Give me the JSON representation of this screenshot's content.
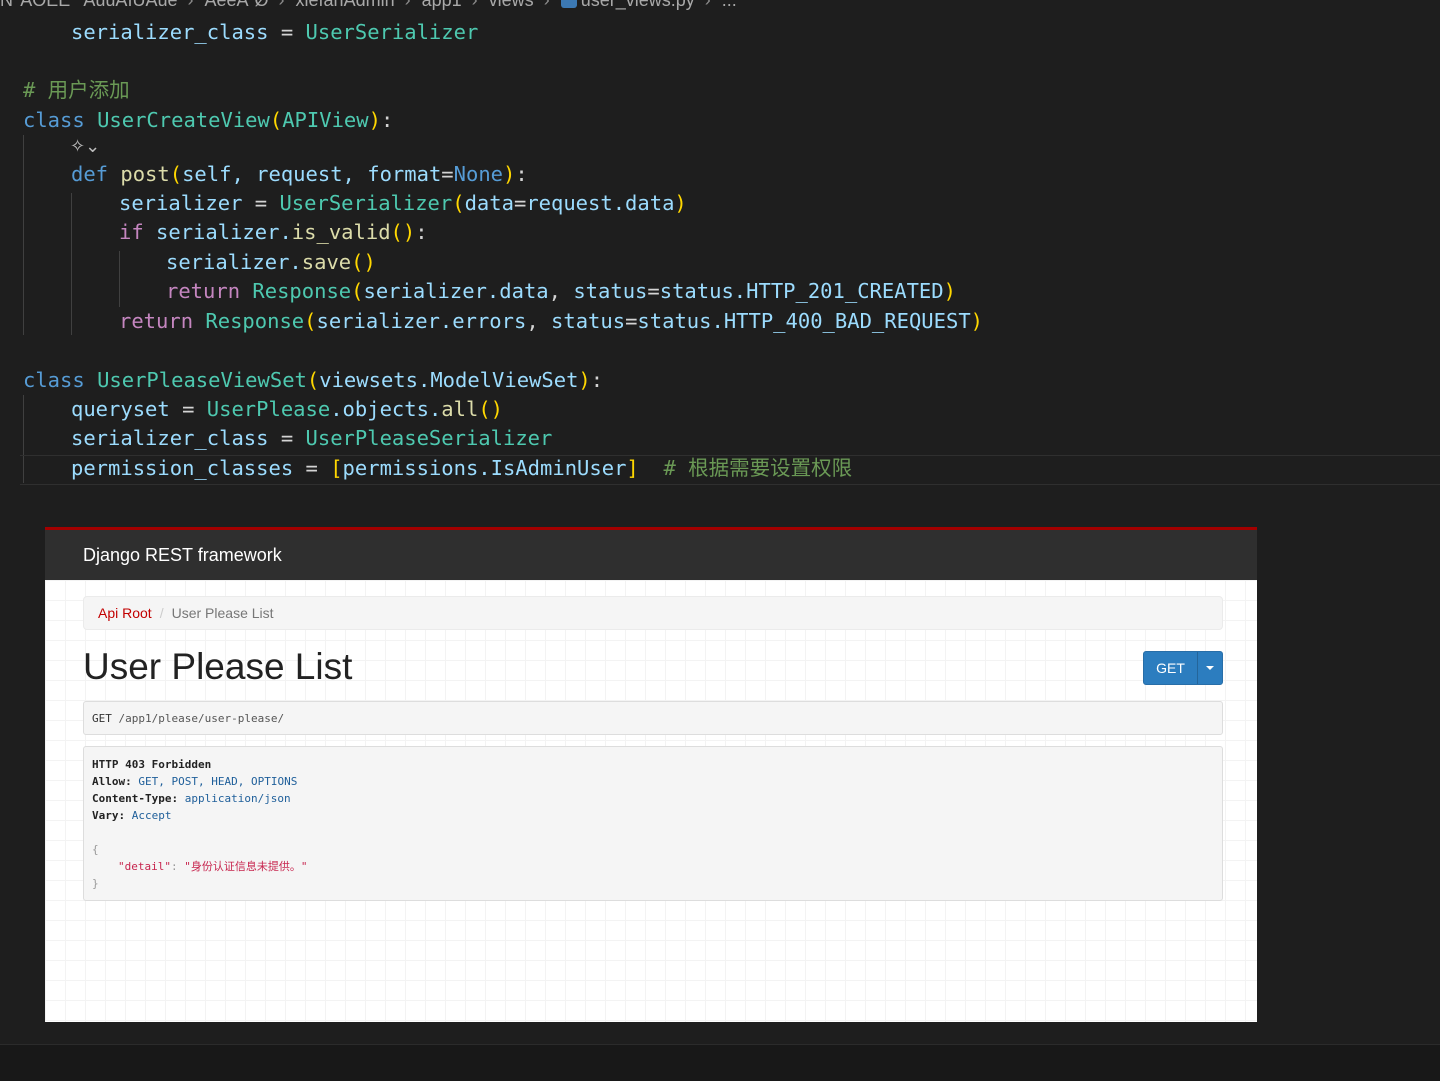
{
  "editor": {
    "breadcrumb": [
      "Ñ°ÂÖÉÊ¨°ÂüüÂïÜÂüé",
      "ÂêéÁ´Ø",
      "xiefanAdmin",
      "app1",
      "views",
      "user_views.py",
      "..."
    ],
    "lines": {
      "l1_var": "serializer_class",
      "l1_eq": " = ",
      "l1_cls": "UserSerializer",
      "l2_comment": "# 用户添加",
      "l3_kw": "class",
      "l3_name": "UserCreateView",
      "l3_base": "APIView",
      "l4_kw": "def",
      "l4_fn": "post",
      "l4_args": "self, request, ",
      "l4_kwarg": "format",
      "l4_default": "None",
      "l5_var": "serializer",
      "l5_cls": "UserSerializer",
      "l5_arg": "data",
      "l5_val": "request.data",
      "l6_kw": "if",
      "l6_expr": "serializer.",
      "l6_fn": "is_valid",
      "l7_obj": "serializer.",
      "l7_fn": "save",
      "l8_kw": "return",
      "l8_cls": "Response",
      "l8_arg1": "serializer.data",
      "l8_kw2": "status",
      "l8_val": "status.HTTP_201_CREATED",
      "l9_kw": "return",
      "l9_cls": "Response",
      "l9_arg1": "serializer.errors",
      "l9_kw2": "status",
      "l9_val": "status.HTTP_400_BAD_REQUEST",
      "l10_kw": "class",
      "l10_name": "UserPleaseViewSet",
      "l10_base": "viewsets.ModelViewSet",
      "l11_var": "queryset",
      "l11_cls": "UserPlease",
      "l11_rest": ".objects.",
      "l11_fn": "all",
      "l12_var": "serializer_class",
      "l12_cls": "UserPleaseSerializer",
      "l13_var": "permission_classes",
      "l13_val": "permissions.IsAdminUser",
      "l13_comment": "# 根据需要设置权限"
    }
  },
  "drf": {
    "brand": "Django REST framework",
    "breadcrumb_root": "Api Root",
    "breadcrumb_current": "User Please List",
    "title": "User Please List",
    "get_button": "GET",
    "request": {
      "method": "GET",
      "path": "/app1/please/user-please/"
    },
    "response": {
      "status": "HTTP 403 Forbidden",
      "allow_label": "Allow:",
      "allow_value": "GET, POST, HEAD, OPTIONS",
      "content_type_label": "Content-Type:",
      "content_type_value": "application/json",
      "vary_label": "Vary:",
      "vary_value": "Accept",
      "open_brace": "{",
      "detail_key": "\"detail\"",
      "detail_colon": ": ",
      "detail_value": "\"身份认证信息未提供。\"",
      "close_brace": "}"
    },
    "colors": {
      "nav_bg": "#2f2f2f",
      "nav_accent": "#a30000",
      "button": "#2c7dbf"
    }
  }
}
